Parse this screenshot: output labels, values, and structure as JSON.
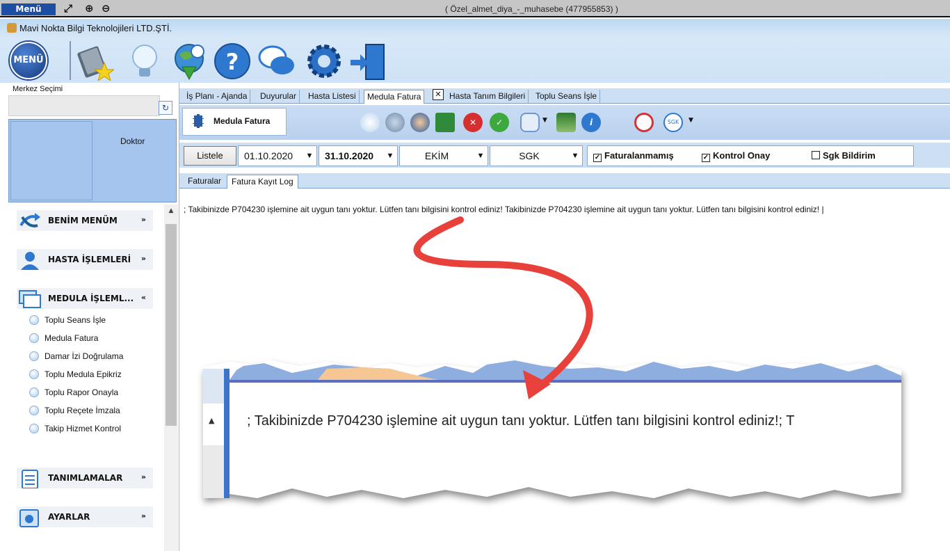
{
  "titlebar": {
    "menu_label": "Menü",
    "window_title": "( Özel_almet_diya_-_muhasebe (477955853) )"
  },
  "app": {
    "name": "Mavi Nokta Bilgi Teknolojileri LTD.ŞTİ.",
    "menu_button": "MENÜ"
  },
  "toolbar_icons": [
    "favorites-book-icon",
    "lightbulb-icon",
    "update-globe-icon",
    "help-icon",
    "chat-icon",
    "settings-gear-icon",
    "exit-door-icon"
  ],
  "sidebar": {
    "merkez_label": "Merkez Seçimi",
    "doctor_label": "Doktor",
    "sections": [
      {
        "label": "BENİM MENÜM",
        "chevron": "»"
      },
      {
        "label": "HASTA İŞLEMLERİ",
        "chevron": "»"
      },
      {
        "label": "MEDULA İŞLEML...",
        "chevron": "«"
      },
      {
        "label": "TANIMLAMALAR",
        "chevron": "»"
      },
      {
        "label": "AYARLAR",
        "chevron": "»"
      }
    ],
    "medula_items": [
      "Toplu Seans İşle",
      "Medula Fatura",
      "Damar İzi Doğrulama",
      "Toplu Medula Epikriz",
      "Toplu Rapor Onayla",
      "Toplu Reçete İmzala",
      "Takip Hizmet Kontrol"
    ]
  },
  "tabs": [
    "İş Planı - Ajanda",
    "Duyurular",
    "Hasta Listesi",
    "Medula Fatura",
    "Hasta Tanım Bilgileri",
    "Toplu Seans İşle"
  ],
  "active_tab": "Medula Fatura",
  "inner": {
    "medula_tab_label": "Medula Fatura"
  },
  "filter": {
    "list_button": "Listele",
    "start_date": "01.10.2020",
    "end_date": "31.10.2020",
    "month": "EKİM",
    "institution": "SGK",
    "checkboxes": [
      {
        "label": "Faturalanmamış",
        "checked": true
      },
      {
        "label": "Kontrol Onay",
        "checked": true
      },
      {
        "label": "Sgk Bildirim",
        "checked": false
      }
    ]
  },
  "subtabs": [
    "Faturalar",
    "Fatura Kayıt Log"
  ],
  "log": {
    "text": "; Takibinizde P704230 işlemine ait uygun tanı yoktur. Lütfen tanı bilgisini kontrol ediniz! Takibinizde P704230 işlemine ait uygun tanı yoktur. Lütfen tanı bilgisini kontrol ediniz! |"
  },
  "callout": {
    "text": "; Takibinizde P704230 işlemine ait uygun tanı yoktur. Lütfen tanı bilgisini kontrol ediniz!; T"
  },
  "colors": {
    "accent": "#1c4ea3",
    "arrow": "#e8403a",
    "panel": "#cddff3"
  }
}
